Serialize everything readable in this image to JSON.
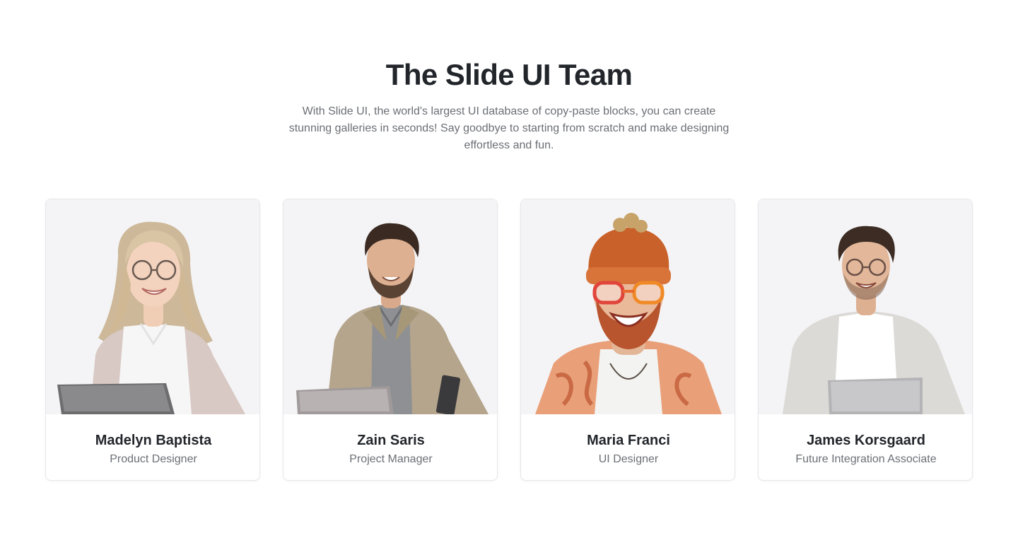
{
  "header": {
    "title": "The Slide UI Team",
    "description": "With Slide UI, the world's largest UI database of copy-paste blocks, you can create stunning galleries in seconds! Say goodbye to starting from scratch and make designing effortless and fun."
  },
  "team": [
    {
      "name": "Madelyn Baptista",
      "role": "Product Designer"
    },
    {
      "name": "Zain Saris",
      "role": "Project Manager"
    },
    {
      "name": "Maria Franci",
      "role": "UI Designer"
    },
    {
      "name": "James Korsgaard",
      "role": "Future Integration Associate"
    }
  ],
  "colors": {
    "heading": "#22262b",
    "body_text": "#6b6f75",
    "photo_background": "#f4f4f6",
    "card_border": "#e6e7ea"
  }
}
